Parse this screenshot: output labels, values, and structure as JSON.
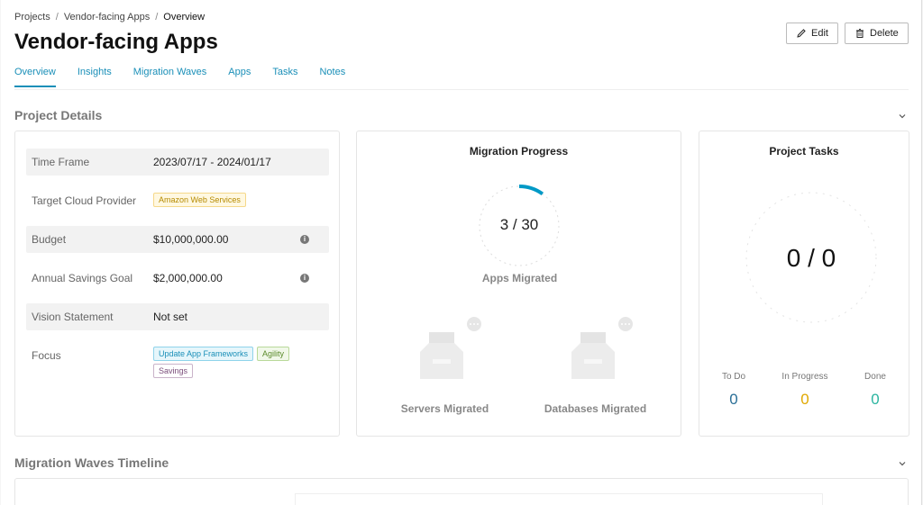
{
  "breadcrumb": [
    "Projects",
    "Vendor-facing Apps",
    "Overview"
  ],
  "page_title": "Vendor-facing Apps",
  "actions": {
    "edit": "Edit",
    "delete": "Delete"
  },
  "tabs": [
    "Overview",
    "Insights",
    "Migration Waves",
    "Apps",
    "Tasks",
    "Notes"
  ],
  "project_details": {
    "section_title": "Project Details",
    "rows": [
      {
        "label": "Time Frame",
        "value": "2023/07/17 - 2024/01/17"
      },
      {
        "label": "Target Cloud Provider",
        "tag": "Amazon Web Services"
      },
      {
        "label": "Budget",
        "value": "$10,000,000.00"
      },
      {
        "label": "Annual Savings Goal",
        "value": "$2,000,000.00"
      },
      {
        "label": "Vision Statement",
        "value": "Not set"
      },
      {
        "label": "Focus",
        "tags": [
          "Update App Frameworks",
          "Agility",
          "Savings"
        ]
      }
    ]
  },
  "migration_progress": {
    "title": "Migration Progress",
    "apps_value": "3 / 30",
    "apps_migrated": 3,
    "apps_total": 30,
    "apps_label": "Apps Migrated",
    "servers_label": "Servers Migrated",
    "databases_label": "Databases Migrated"
  },
  "project_tasks": {
    "title": "Project Tasks",
    "value": "0 / 0",
    "stats": [
      {
        "label": "To Do",
        "value": "0",
        "color": "#2a6f97"
      },
      {
        "label": "In Progress",
        "value": "0",
        "color": "#e0a800"
      },
      {
        "label": "Done",
        "value": "0",
        "color": "#2bb5a0"
      }
    ]
  },
  "timeline": {
    "section_title": "Migration Waves Timeline"
  },
  "colors": {
    "accent": "#1a8fb8",
    "progress": "#0099c6"
  }
}
